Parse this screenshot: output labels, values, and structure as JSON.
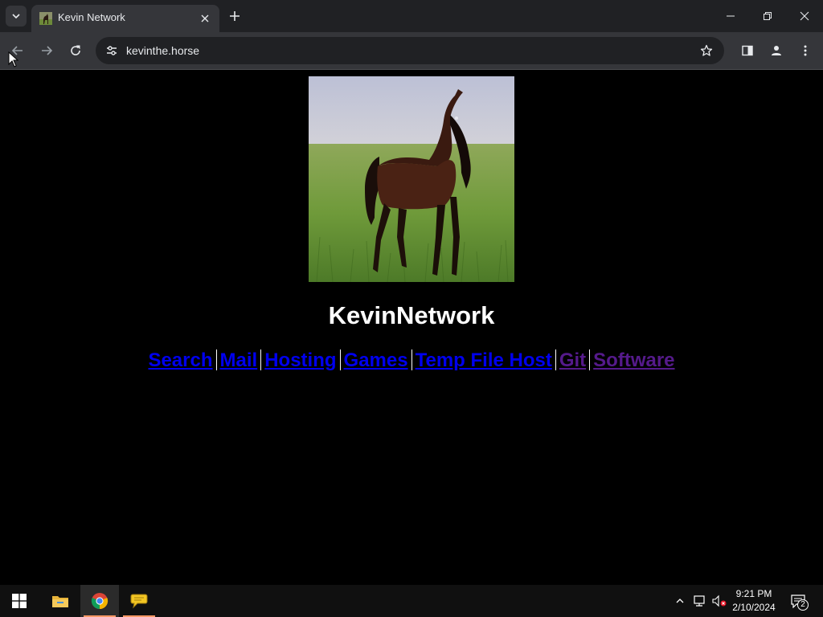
{
  "browser": {
    "tab": {
      "title": "Kevin Network"
    },
    "url": "kevinthe.horse"
  },
  "page": {
    "title": "KevinNetwork",
    "nav_links": [
      {
        "label": "Search",
        "state": "unvisited"
      },
      {
        "label": "Mail",
        "state": "unvisited"
      },
      {
        "label": "Hosting",
        "state": "unvisited"
      },
      {
        "label": "Games",
        "state": "unvisited"
      },
      {
        "label": "Temp File Host",
        "state": "unvisited"
      },
      {
        "label": "Git",
        "state": "visited"
      },
      {
        "label": "Software",
        "state": "visited"
      }
    ],
    "colors": {
      "link": "#0000ee",
      "visited_link": "#551a8b",
      "background": "#000000"
    }
  },
  "taskbar": {
    "time": "9:21 PM",
    "date": "2/10/2024",
    "notification_count": "2",
    "pinned": [
      "start-icon",
      "file-explorer-icon",
      "chrome-icon",
      "chat-bubble-icon"
    ]
  }
}
